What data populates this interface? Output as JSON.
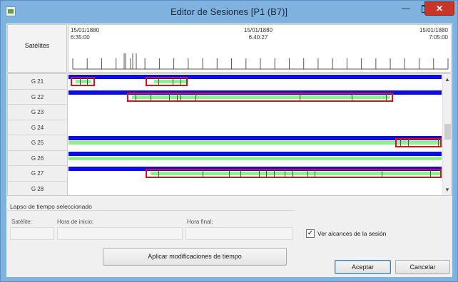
{
  "window": {
    "title": "Editor de Sesiones [P1 (B7)]",
    "minimize_glyph": "—",
    "close_glyph": "✕"
  },
  "header": {
    "satellites_label": "Satélites",
    "time_start": "15/01/1880\n6:35:00",
    "time_mid": "15/01/1880\n6:40:27",
    "time_end": "15/01/1880\n7:05:00"
  },
  "rows": [
    {
      "label": "G 21",
      "blue": true,
      "green": [
        {
          "from": 0.02,
          "to": 0.06
        },
        {
          "from": 0.23,
          "to": 0.32
        }
      ],
      "ticks": [
        0.03,
        0.05,
        0.24,
        0.28,
        0.3
      ],
      "highlights": [
        {
          "from": 0.01,
          "to": 0.07
        },
        {
          "from": 0.21,
          "to": 0.32
        }
      ]
    },
    {
      "label": "G 22",
      "blue": true,
      "green": [
        {
          "from": 0.17,
          "to": 0.86
        }
      ],
      "ticks": [
        0.18,
        0.22,
        0.27,
        0.29,
        0.3,
        0.34,
        0.62,
        0.76,
        0.85
      ],
      "highlights": [
        {
          "from": 0.16,
          "to": 0.87
        }
      ]
    },
    {
      "label": "G 23",
      "blue": false,
      "green": [],
      "ticks": [],
      "highlights": []
    },
    {
      "label": "G 24",
      "blue": false,
      "green": [],
      "ticks": [],
      "highlights": []
    },
    {
      "label": "G 25",
      "blue": true,
      "green": [
        {
          "from": 0.0,
          "to": 1.0
        }
      ],
      "ticks": [
        0.89,
        0.91,
        0.99
      ],
      "highlights": [
        {
          "from": 0.88,
          "to": 1.0
        }
      ]
    },
    {
      "label": "G 26",
      "blue": true,
      "green": [
        {
          "from": 0.0,
          "to": 1.0
        }
      ],
      "ticks": [],
      "highlights": []
    },
    {
      "label": "G 27",
      "blue": true,
      "green": [
        {
          "from": 0.22,
          "to": 1.0
        }
      ],
      "ticks": [
        0.24,
        0.36,
        0.43,
        0.46,
        0.51,
        0.53,
        0.55,
        0.58,
        0.6,
        0.64,
        0.66,
        0.84,
        0.97
      ],
      "highlights": [
        {
          "from": 0.21,
          "to": 1.0
        }
      ]
    },
    {
      "label": "G 28",
      "blue": false,
      "green": [],
      "ticks": [],
      "highlights": []
    }
  ],
  "selection_group": {
    "caption": "Lapso de tiempo seleccionado",
    "satellite_label": "Satélite:",
    "start_label": "Hora de inicio:",
    "end_label": "Hora final:",
    "satellite_value": "",
    "start_value": "",
    "end_value": "",
    "apply_button": "Aplicar modificaciones de tiempo"
  },
  "options": {
    "show_ranges_label": "Ver alcances de la sesión",
    "show_ranges_checked": true
  },
  "buttons": {
    "accept": "Aceptar",
    "cancel": "Cancelar"
  },
  "colors": {
    "session_bar": "#0a0aee",
    "visibility_bar": "#8ff08f",
    "highlight": "#e01010",
    "title_bar": "#7fb2df",
    "close_button": "#c7352b"
  }
}
